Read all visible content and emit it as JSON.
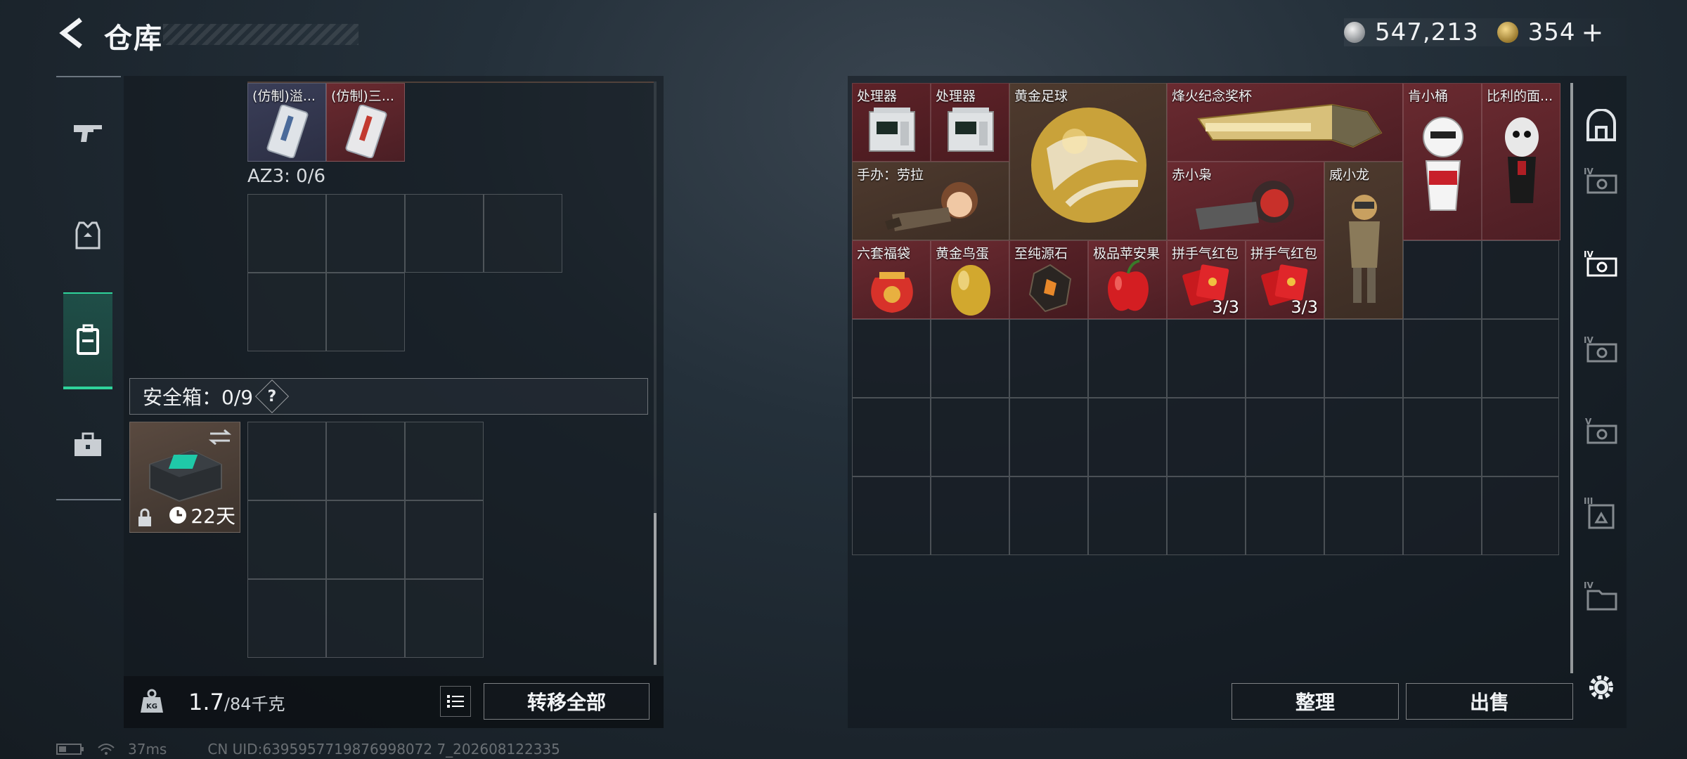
{
  "header": {
    "title": "仓库",
    "currency": [
      {
        "icon": "silver-coin-icon",
        "value": "547,213"
      },
      {
        "icon": "gold-coin-icon",
        "value": "354"
      }
    ],
    "plus": "+"
  },
  "left_nav": [
    "weapon-icon",
    "armor-icon",
    "backpack-icon",
    "toolbox-icon"
  ],
  "left": {
    "items": [
      {
        "label": "(仿制)溢..."
      },
      {
        "label": "(仿制)三..."
      }
    ],
    "az3_label": "AZ3: 0/6",
    "safe_label": "安全箱：0/9",
    "help": "?",
    "safe_days": "22天",
    "weight": "1.7",
    "weight_max": "/84千克",
    "transfer_all": "转移全部"
  },
  "right": {
    "items": [
      {
        "label": "处理器"
      },
      {
        "label": "处理器"
      },
      {
        "label": "黄金足球"
      },
      {
        "label": "烽火纪念奖杯"
      },
      {
        "label": "肯小桶"
      },
      {
        "label": "比利的面..."
      },
      {
        "label": "手办：劳拉"
      },
      {
        "label": "赤小枭"
      },
      {
        "label": "威小龙"
      },
      {
        "label": "六套福袋"
      },
      {
        "label": "黄金鸟蛋"
      },
      {
        "label": "至纯源石"
      },
      {
        "label": "极品苹安果"
      },
      {
        "label": "拼手气红包",
        "count": "3/3"
      },
      {
        "label": "拼手气红包",
        "count": "3/3"
      }
    ],
    "sort": "整理",
    "sell": "出售"
  },
  "status": {
    "ping": "37ms",
    "uid": "CN UID:6395957719876998072 7_202608122335"
  },
  "colors": {
    "accent": "#2fd39b",
    "item_red": "#5a2228",
    "item_brown": "#4a3a30"
  }
}
